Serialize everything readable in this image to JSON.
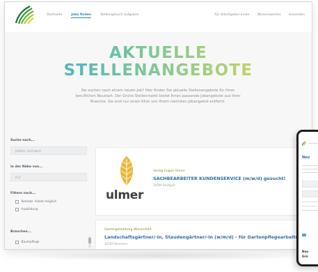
{
  "nav": {
    "left": [
      "Startseite",
      "Jobs finden",
      "Stellengesuch aufgeben"
    ],
    "active_index": 1,
    "right": [
      "Für Arbeitgeber:innen",
      "Wissenswertes",
      "Anmelden"
    ]
  },
  "hero": {
    "title_line1": "AKTUELLE",
    "title_line2": "STELLENANGEBOTE",
    "intro": "Sie suchen nach einem neuen Job? Hier finden Sie aktuelle Stellenangebote für Ihren beruflichen Neustart. Der Grüne Stellenmarkt bietet Ihnen passende Jobangebote aus Ihrer Branche. Sie sind nur einen Klick von Ihrem nächsten Jobangebot entfernt."
  },
  "filters": {
    "search_label": "Suche nach...",
    "search_placeholder": "Jobtitel, Stichwort",
    "near_label": "In der Nähe von...",
    "near_placeholder": "PLZ",
    "filter_label": "Filtern nach...",
    "options": [
      "Remote: Arbeit möglich",
      "Ausbildung"
    ],
    "branches_label": "Branchen...",
    "branches": [
      "Baumpflege"
    ]
  },
  "jobs": [
    {
      "company": "Verlag Eugen Ulmer",
      "title": "SACHBEARBEITER KUNDENSERVICE (m/w/d) gesucht!",
      "location": "70599 Stuttgart",
      "logo_text": "ulmer"
    },
    {
      "company": "Gartengestaltung Wiesenfeld",
      "title": "Landschaftsgärtner/-in, Staudengärtner/-in (w/m/d) - für Gartenpflegearbeiten",
      "location": "30169 Hannover"
    }
  ],
  "phone": {
    "heading": "Neu",
    "bottom_text_1": "Bau",
    "bottom_text_2": "Grü"
  },
  "colors": {
    "accent_blue": "#2f87b8",
    "title_gradient": [
      "#2fa8dd",
      "#7cc69a",
      "#e4d94a"
    ],
    "company_green": "#7d8a35"
  }
}
